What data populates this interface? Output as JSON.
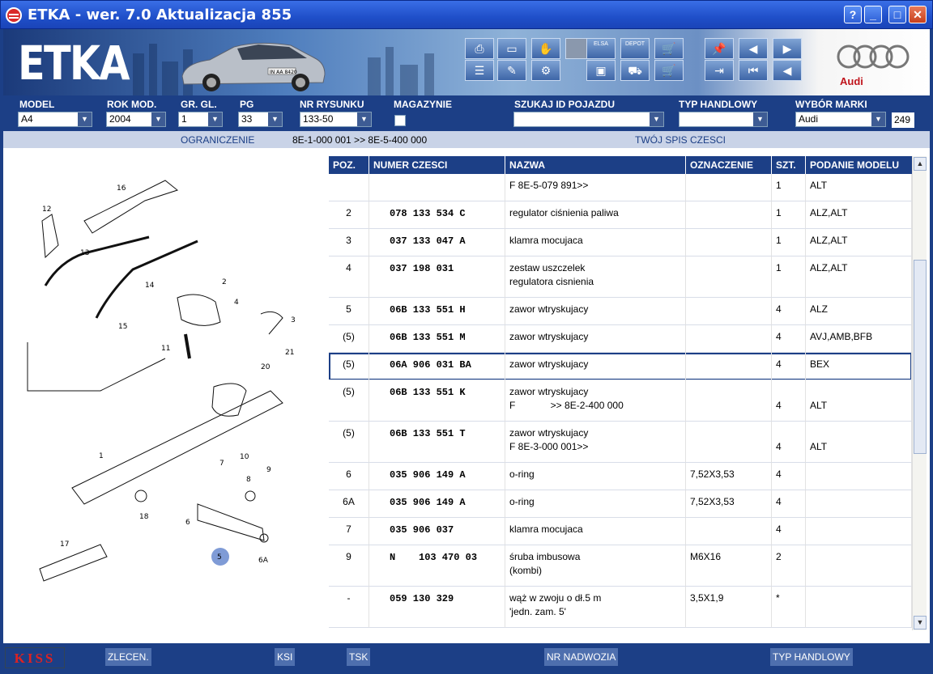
{
  "window": {
    "title": "ETKA - wer. 7.0 Aktualizacja 855",
    "help": "?",
    "minimize": "_",
    "maximize": "□",
    "close": "✕"
  },
  "banner": {
    "logo": "ETKA",
    "brand": "Audi",
    "car_plate": "IN AA 8420",
    "toolbar_labels": {
      "elsa": "ELSA",
      "depot": "DEPOT"
    }
  },
  "filters": {
    "model": {
      "label": "MODEL",
      "value": "A4"
    },
    "rok": {
      "label": "ROK MOD.",
      "value": "2004"
    },
    "gr": {
      "label": "GR. GL.",
      "value": "1"
    },
    "pg": {
      "label": "PG",
      "value": "33"
    },
    "nr": {
      "label": "NR RYSUNKU",
      "value": "133-50"
    },
    "magazynie": {
      "label": "MAGAZYNIE"
    },
    "szukaj": {
      "label": "SZUKAJ ID POJAZDU",
      "value": ""
    },
    "typ": {
      "label": "TYP HANDLOWY",
      "value": ""
    },
    "marka": {
      "label": "WYBÓR MARKI",
      "value": "Audi"
    },
    "count": "249"
  },
  "info": {
    "ograniczenie_label": "OGRANICZENIE",
    "ograniczenie_value": "8E-1-000 001 >> 8E-5-400 000",
    "twoj": "TWÓJ SPIS CZESCI"
  },
  "table": {
    "headers": {
      "poz": "POZ.",
      "numer": "NUMER CZESCI",
      "nazwa": "NAZWA",
      "oznaczenie": "OZNACZENIE",
      "szt": "SZT.",
      "podanie": "PODANIE MODELU"
    },
    "rows": [
      {
        "poz": "",
        "numer": "",
        "nazwa1": "F 8E-5-079 891>>",
        "nazwa2": "",
        "ozn": "",
        "szt": "1",
        "model": "ALT"
      },
      {
        "poz": "2",
        "numer": "078 133 534 C",
        "nazwa1": "regulator ciśnienia paliwa",
        "nazwa2": "",
        "ozn": "",
        "szt": "1",
        "model": "ALZ,ALT"
      },
      {
        "poz": "3",
        "numer": "037 133 047 A",
        "nazwa1": "klamra mocujaca",
        "nazwa2": "",
        "ozn": "",
        "szt": "1",
        "model": "ALZ,ALT"
      },
      {
        "poz": "4",
        "numer": "037 198 031",
        "nazwa1": "zestaw uszczelek",
        "nazwa2": "regulatora cisnienia",
        "ozn": "",
        "szt": "1",
        "model": "ALZ,ALT"
      },
      {
        "poz": "5",
        "numer": "06B 133 551 H",
        "nazwa1": "zawor wtryskujacy",
        "nazwa2": "",
        "ozn": "",
        "szt": "4",
        "model": "ALZ"
      },
      {
        "poz": "(5)",
        "numer": "06B 133 551 M",
        "nazwa1": "zawor wtryskujacy",
        "nazwa2": "",
        "ozn": "",
        "szt": "4",
        "model": "AVJ,AMB,BFB"
      },
      {
        "poz": "(5)",
        "numer": "06A 906 031 BA",
        "nazwa1": "zawor wtryskujacy",
        "nazwa2": "",
        "ozn": "",
        "szt": "4",
        "model": "BEX"
      },
      {
        "poz": "(5)",
        "numer": "06B 133 551 K",
        "nazwa1": "zawor wtryskujacy",
        "nazwa2": "F             >> 8E-2-400 000",
        "ozn": "",
        "szt": "4",
        "model": "ALT"
      },
      {
        "poz": "(5)",
        "numer": "06B 133 551 T",
        "nazwa1": "zawor wtryskujacy",
        "nazwa2": "F 8E-3-000 001>>",
        "ozn": "",
        "szt": "4",
        "model": "ALT"
      },
      {
        "poz": "6",
        "numer": "035 906 149 A",
        "nazwa1": "o-ring",
        "nazwa2": "",
        "ozn": "7,52X3,53",
        "szt": "4",
        "model": ""
      },
      {
        "poz": "6A",
        "numer": "035 906 149 A",
        "nazwa1": "o-ring",
        "nazwa2": "",
        "ozn": "7,52X3,53",
        "szt": "4",
        "model": ""
      },
      {
        "poz": "7",
        "numer": "035 906 037",
        "nazwa1": "klamra mocujaca",
        "nazwa2": "",
        "ozn": "",
        "szt": "4",
        "model": ""
      },
      {
        "poz": "9",
        "numer": "N    103 470 03",
        "nazwa1": "śruba imbusowa",
        "nazwa2": "(kombi)",
        "ozn": "M6X16",
        "szt": "2",
        "model": ""
      },
      {
        "poz": "-",
        "numer": "059 130 329",
        "nazwa1": "wąż w zwoju o dł.5 m",
        "nazwa2": "'jedn. zam. 5'",
        "ozn": "3,5X1,9",
        "szt": "*",
        "model": ""
      }
    ]
  },
  "diagram_labels": [
    "16",
    "12",
    "13",
    "14",
    "2",
    "4",
    "3",
    "15",
    "11",
    "21",
    "20",
    "1",
    "10",
    "9",
    "7",
    "8",
    "6",
    "5",
    "6A",
    "18",
    "17"
  ],
  "footer": {
    "kiss": "KISS",
    "zlecen": "ZLECEN.",
    "ksi": "KSI",
    "tsk": "TSK",
    "nadwozia": "NR NADWOZIA",
    "typ": "TYP HANDLOWY"
  }
}
